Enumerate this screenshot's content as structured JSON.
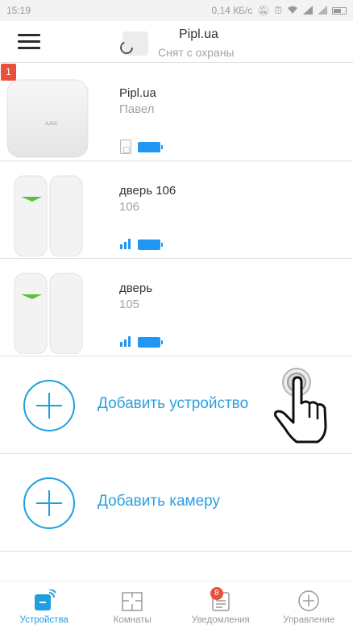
{
  "status_bar": {
    "time": "15:19",
    "speed": "0,14 КБ/с"
  },
  "header": {
    "title": "Pipl.ua",
    "status": "Снят с охраны"
  },
  "devices": [
    {
      "name": "Pipl.ua",
      "sub": "Павел",
      "badge": "1",
      "kind": "hub",
      "brand": "AJAX"
    },
    {
      "name": "дверь 106",
      "sub": "106",
      "kind": "door"
    },
    {
      "name": "дверь",
      "sub": "105",
      "kind": "door"
    }
  ],
  "add": {
    "device": "Добавить устройство",
    "camera": "Добавить камеру"
  },
  "nav": [
    {
      "label": "Устройства",
      "active": true
    },
    {
      "label": "Комнаты"
    },
    {
      "label": "Уведомления",
      "badge": "8"
    },
    {
      "label": "Управление"
    }
  ],
  "colors": {
    "accent": "#1f9fe0",
    "badge": "#e8503a",
    "battery": "#2196f3"
  }
}
